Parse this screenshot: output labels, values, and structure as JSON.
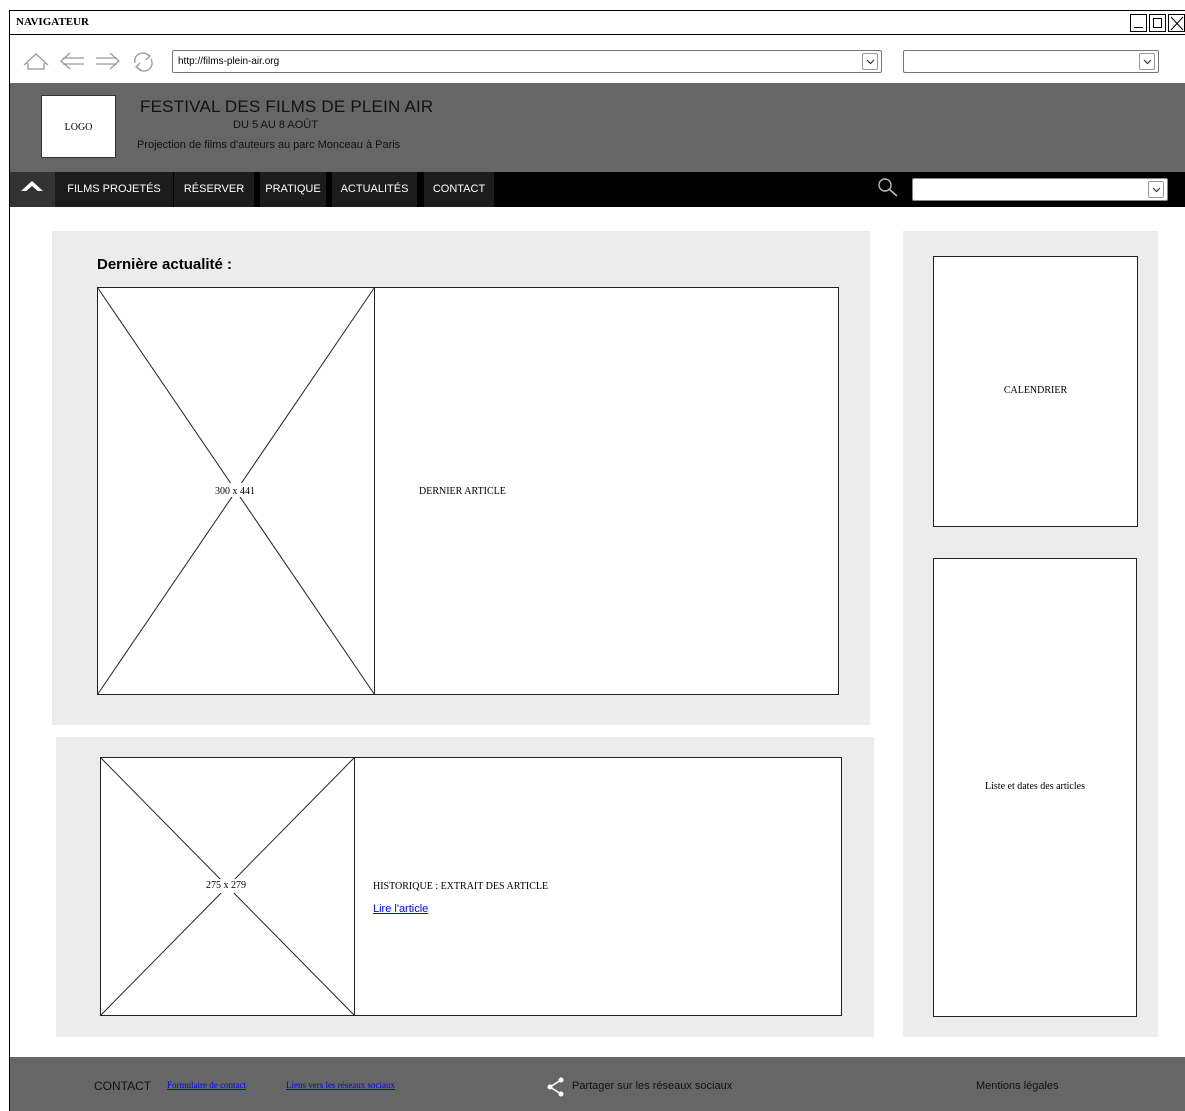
{
  "window": {
    "title": "NAVIGATEUR"
  },
  "browser": {
    "url": "http://films-plein-air.org",
    "search_value": ""
  },
  "header": {
    "logo_text": "LOGO",
    "title": "FESTIVAL DES FILMS DE PLEIN AIR",
    "dates": "DU 5 AU 8 AOÛT",
    "tagline": "Projection de films d'auteurs au parc Monceau à Paris"
  },
  "nav": {
    "items": [
      "FILMS PROJETÉS",
      "RÉSERVER",
      "PRATIQUE",
      "ACTUALITÉS",
      "CONTACT"
    ],
    "search_value": ""
  },
  "main": {
    "latest_heading": "Dernière actualité :",
    "latest_image_label": "300 x 441",
    "latest_article_label": "DERNIER ARTICLE",
    "history_image_label": "275 x 279",
    "history_text": "HISTORIQUE : EXTRAIT DES ARTICLE",
    "history_link": "Lire l'article"
  },
  "sidebar": {
    "calendar_label": "CALENDRIER",
    "articles_list_label": "Liste et dates des articles"
  },
  "footer": {
    "contact_label": "CONTACT",
    "contact_form_link": "Formulaire de contact",
    "social_links": "Liens vers les réseaux sociaux",
    "share_label": "Partager sur les réseaux sociaux",
    "legal_label": "Mentions légales"
  },
  "colors": {
    "header_bg": "#666666",
    "nav_bg": "#000000",
    "panel_bg": "#ececec",
    "link": "#0000ff"
  }
}
